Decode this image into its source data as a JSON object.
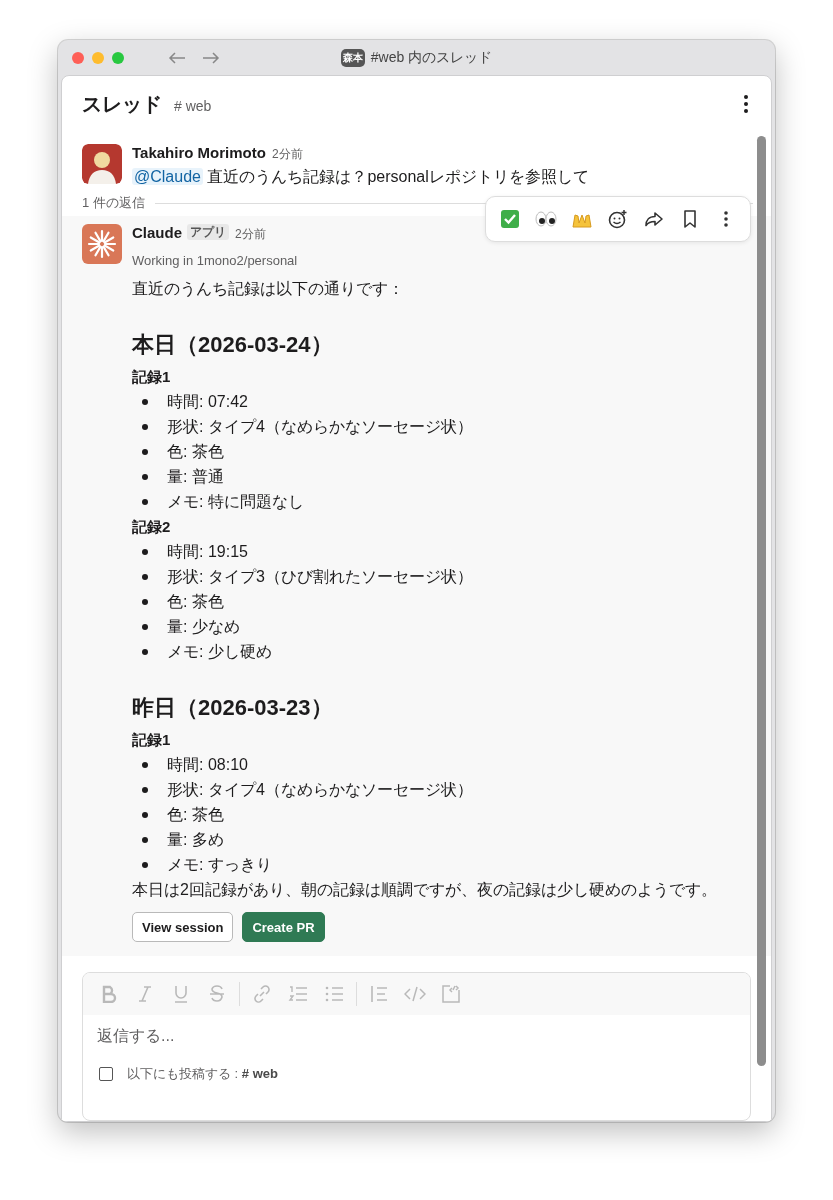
{
  "window": {
    "title": "#web 内のスレッド",
    "badge": "森本"
  },
  "header": {
    "title": "スレッド",
    "channel": "# web"
  },
  "message": {
    "author": "Takahiro Morimoto",
    "time": "2分前",
    "mention": "@Claude",
    "text": "直近のうんち記録は？personalレポジトリを参照して"
  },
  "replies_count": "1 件の返信",
  "hover_actions": [
    {
      "kind": "check"
    },
    {
      "kind": "eyes"
    },
    {
      "kind": "hands"
    },
    {
      "kind": "add-reaction"
    },
    {
      "kind": "share"
    },
    {
      "kind": "bookmark"
    },
    {
      "kind": "more"
    }
  ],
  "reply": {
    "author": "Claude",
    "badge": "アプリ",
    "time": "2分前",
    "subtitle": "Working in 1mono2/personal",
    "blocks": [
      {
        "kind": "paragraph",
        "text": "直近のうんち記録は以下の通りです："
      },
      {
        "kind": "heading",
        "text": "本日（2026-03-24）"
      },
      {
        "kind": "label",
        "text": "記録1"
      },
      {
        "kind": "bullets",
        "items": [
          "時間: 07:42",
          "形状: タイプ4（なめらかなソーセージ状）",
          "色: 茶色",
          "量: 普通",
          "メモ: 特に問題なし"
        ]
      },
      {
        "kind": "label",
        "text": "記録2"
      },
      {
        "kind": "bullets",
        "items": [
          "時間: 19:15",
          "形状: タイプ3（ひび割れたソーセージ状）",
          "色: 茶色",
          "量: 少なめ",
          "メモ: 少し硬め"
        ]
      },
      {
        "kind": "heading",
        "text": "昨日（2026-03-23）"
      },
      {
        "kind": "label",
        "text": "記録1"
      },
      {
        "kind": "bullets",
        "items": [
          "時間: 08:10",
          "形状: タイプ4（なめらかなソーセージ状）",
          "色: 茶色",
          "量: 多め",
          "メモ: すっきり"
        ]
      },
      {
        "kind": "paragraph",
        "text": "本日は2回記録があり、朝の記録は順調ですが、夜の記録は少し硬めのようです。"
      }
    ],
    "buttons": [
      {
        "label": "View session",
        "kind": "secondary"
      },
      {
        "label": "Create PR",
        "kind": "primary"
      }
    ]
  },
  "composer": {
    "tools": [
      {
        "kind": "bold"
      },
      {
        "kind": "italic"
      },
      {
        "kind": "underline"
      },
      {
        "kind": "strike"
      },
      {
        "kind": "divider"
      },
      {
        "kind": "link"
      },
      {
        "kind": "ordered"
      },
      {
        "kind": "bulleted"
      },
      {
        "kind": "divider"
      },
      {
        "kind": "quote"
      },
      {
        "kind": "code"
      },
      {
        "kind": "codeblock"
      }
    ],
    "placeholder": "返信する...",
    "also_post": {
      "label": "以下にも投稿する :",
      "channel": "# web",
      "checked": false
    }
  }
}
